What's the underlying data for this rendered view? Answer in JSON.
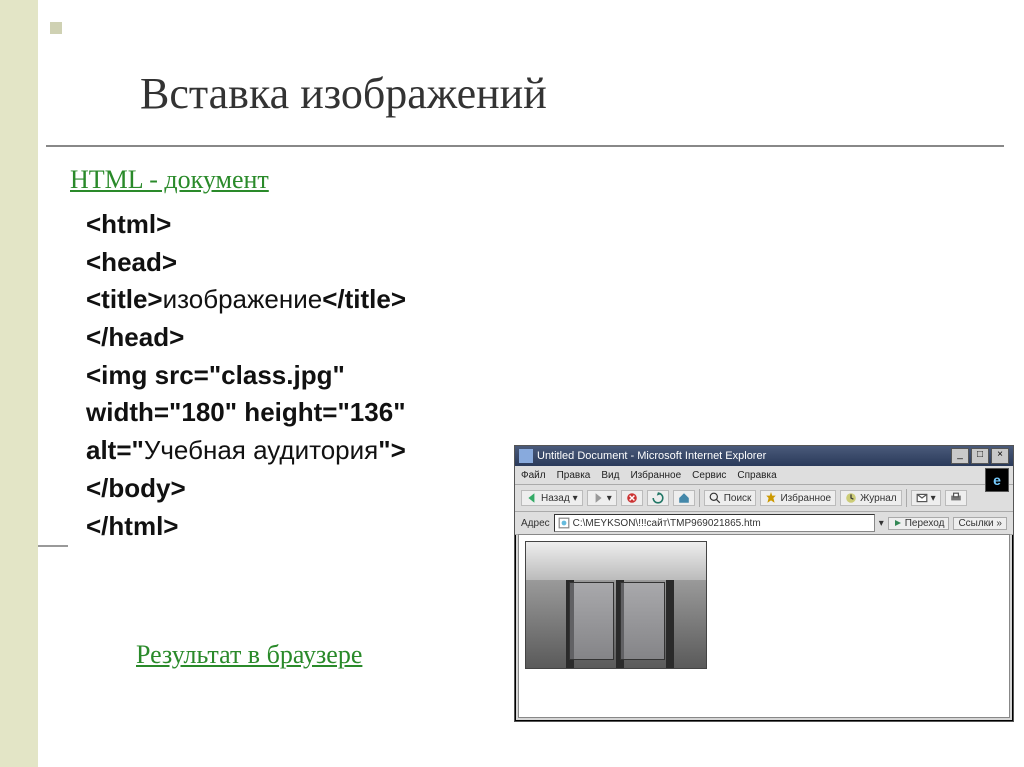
{
  "slide": {
    "title": "Вставка изображений",
    "link_html_doc": "HTML - документ",
    "link_result": "Результат в браузере"
  },
  "code": {
    "l1": "<html>",
    "l2": "<head>",
    "l3a": "<title>",
    "l3b": "изображение",
    "l3c": "</title>",
    "l4": "</head>",
    "l5": "<img src=\"class.jpg\"",
    "l6": "width=\"180\" height=\"136\"",
    "l7a": "alt=\"",
    "l7b": "Учебная аудитория",
    "l7c": "\">",
    "l8": "</body>",
    "l9": "</html>"
  },
  "browser": {
    "title": "Untitled Document - Microsoft Internet Explorer",
    "min": "_",
    "max": "□",
    "close": "×",
    "menu": [
      "Файл",
      "Правка",
      "Вид",
      "Избранное",
      "Сервис",
      "Справка"
    ],
    "toolbar": {
      "back": "Назад",
      "search": "Поиск",
      "fav": "Избранное",
      "journal": "Журнал"
    },
    "address_label": "Адрес",
    "address_value": "C:\\MEYKSON\\!!!сайт\\TMP969021865.htm",
    "go": "Переход",
    "links": "Ссылки",
    "ie": "e"
  }
}
